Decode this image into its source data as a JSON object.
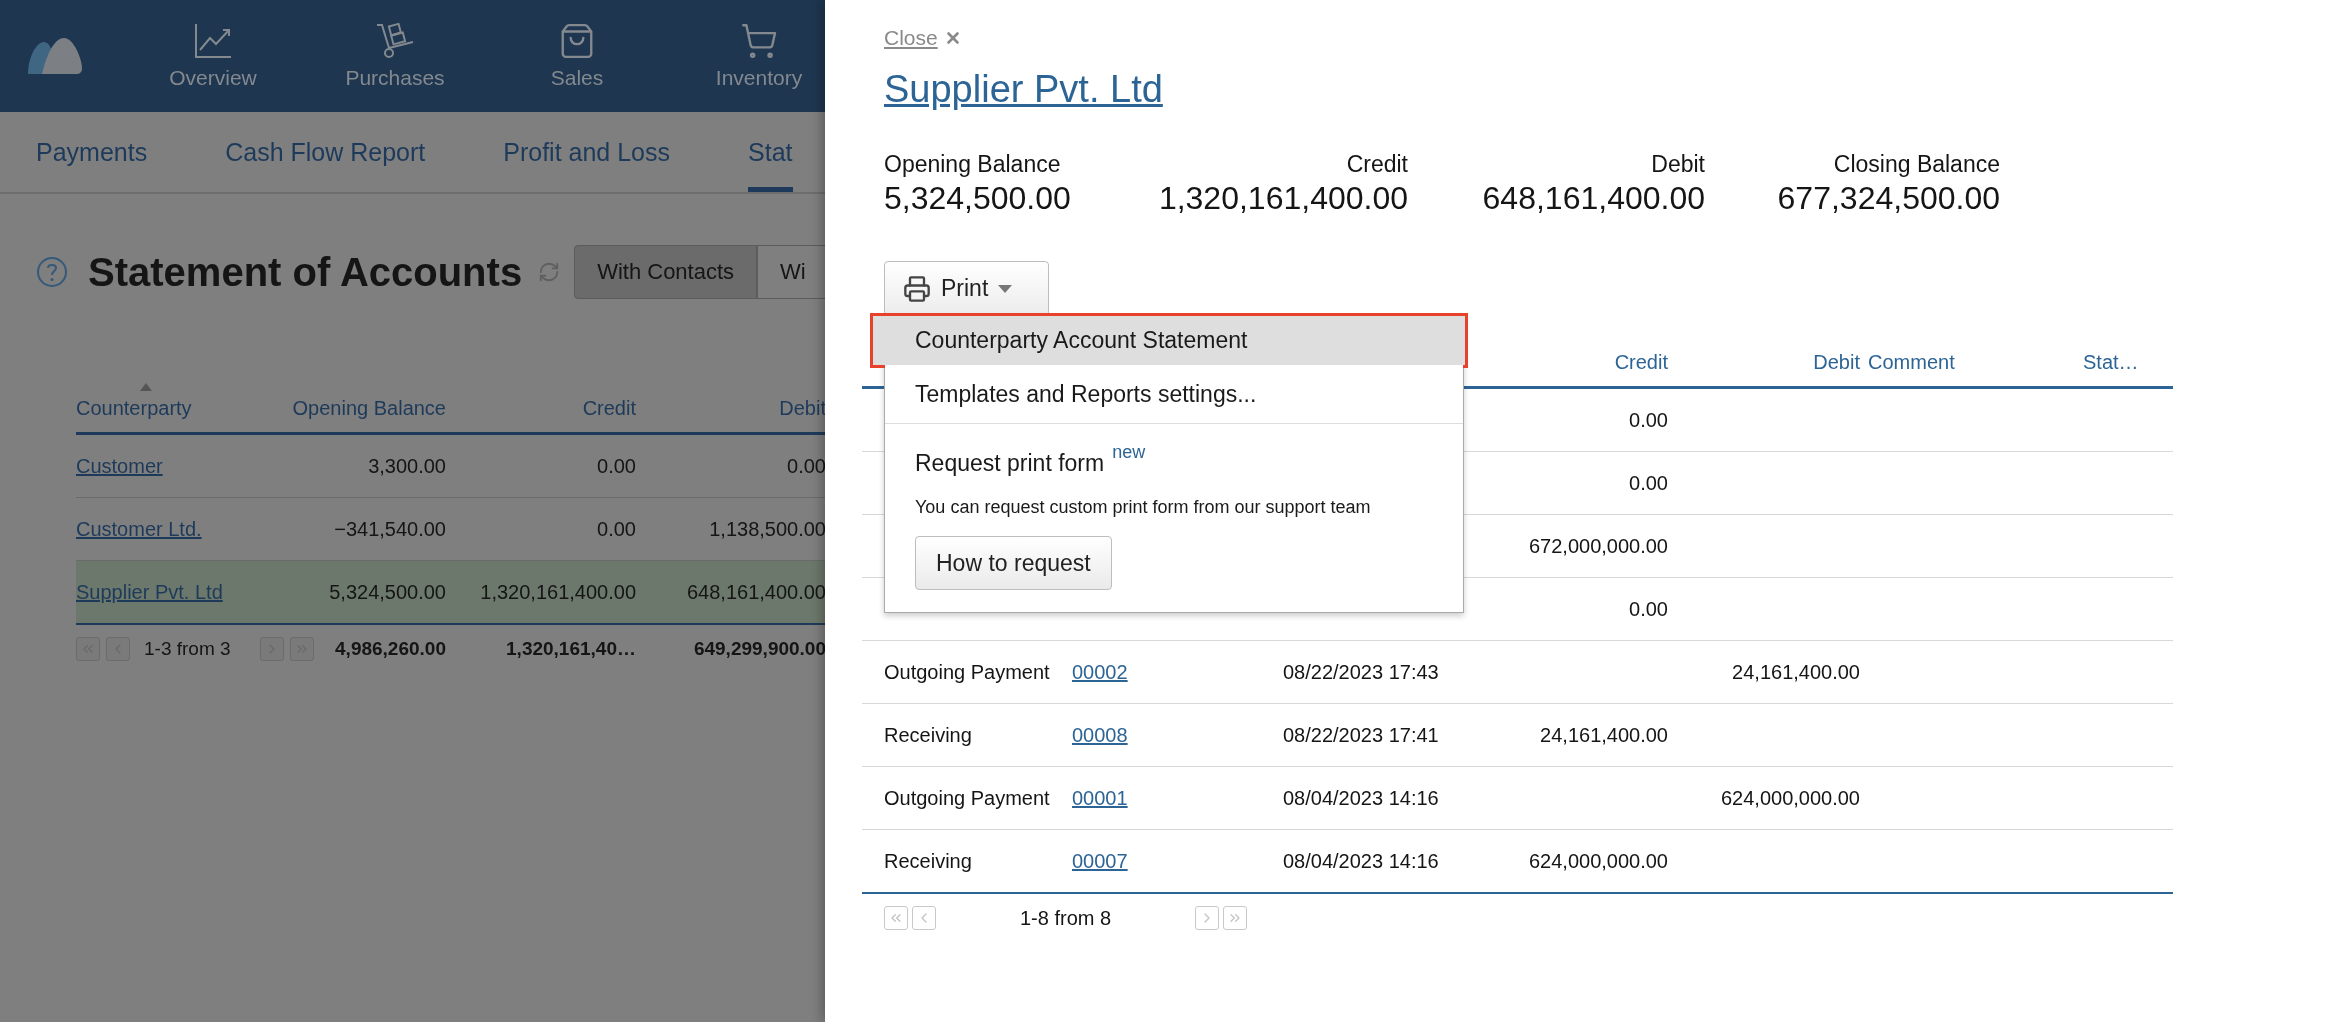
{
  "background": {
    "nav": [
      {
        "label": "Overview",
        "kind": "chart"
      },
      {
        "label": "Purchases",
        "kind": "dolly"
      },
      {
        "label": "Sales",
        "kind": "bag"
      },
      {
        "label": "Inventory",
        "kind": "cart"
      }
    ],
    "subnav": [
      {
        "label": "Payments",
        "selected": false
      },
      {
        "label": "Cash Flow Report",
        "selected": false
      },
      {
        "label": "Profit and Loss",
        "selected": false
      },
      {
        "label": "Stat",
        "selected": true
      }
    ],
    "title": "Statement of Accounts",
    "view_toggle": [
      {
        "label": "With Contacts",
        "selected": true
      },
      {
        "label": "Wi",
        "selected": false
      }
    ],
    "table": {
      "columns": [
        {
          "label": "Counterparty",
          "sorted": true
        },
        {
          "label": "Opening Balance",
          "sorted": false
        },
        {
          "label": "Credit",
          "sorted": false
        },
        {
          "label": "Debit",
          "sorted": false
        }
      ],
      "rows": [
        {
          "counterparty": "Customer",
          "opening_balance": "3,300.00",
          "credit": "0.00",
          "debit": "0.00",
          "selected": false
        },
        {
          "counterparty": "Customer Ltd.",
          "opening_balance": "−341,540.00",
          "credit": "0.00",
          "debit": "1,138,500.00",
          "selected": false
        },
        {
          "counterparty": "Supplier Pvt. Ltd",
          "opening_balance": "5,324,500.00",
          "credit": "1,320,161,400.00",
          "debit": "648,161,400.00",
          "selected": true
        }
      ],
      "footer": {
        "count": "1-3 from 3",
        "totals": [
          "4,986,260.00",
          "1,320,161,40…",
          "649,299,900.00"
        ]
      }
    }
  },
  "panel": {
    "close_label": "Close",
    "title": "Supplier Pvt. Ltd",
    "summary": [
      {
        "label": "Opening Balance",
        "value": "5,324,500.00"
      },
      {
        "label": "Credit",
        "value": "1,320,161,400.00"
      },
      {
        "label": "Debit",
        "value": "648,161,400.00"
      },
      {
        "label": "Closing Balance",
        "value": "677,324,500.00"
      }
    ],
    "print_button": "Print",
    "print_menu": {
      "items": [
        {
          "label": "Counterparty Account Statement",
          "selected": true
        },
        {
          "label": "Templates and Reports settings...",
          "selected": false
        }
      ],
      "request": {
        "label": "Request print form",
        "badge": "new",
        "description": "You can request custom print form from our support team",
        "button": "How to request"
      }
    },
    "table": {
      "columns": [
        "Credit",
        "Debit",
        "Comment",
        "Stat…"
      ],
      "rows": [
        {
          "credit": "0.00"
        },
        {
          "credit": "0.00"
        },
        {
          "credit": "672,000,000.00"
        },
        {
          "credit": "0.00"
        },
        {
          "type": "Outgoing Payment",
          "number": "00002",
          "date": "08/22/2023 17:43",
          "debit": "24,161,400.00"
        },
        {
          "type": "Receiving",
          "number": "00008",
          "date": "08/22/2023 17:41",
          "credit": "24,161,400.00"
        },
        {
          "type": "Outgoing Payment",
          "number": "00001",
          "date": "08/04/2023 14:16",
          "debit": "624,000,000.00"
        },
        {
          "type": "Receiving",
          "number": "00007",
          "date": "08/04/2023 14:16",
          "credit": "624,000,000.00"
        }
      ],
      "pager": "1-8 from 8"
    }
  }
}
